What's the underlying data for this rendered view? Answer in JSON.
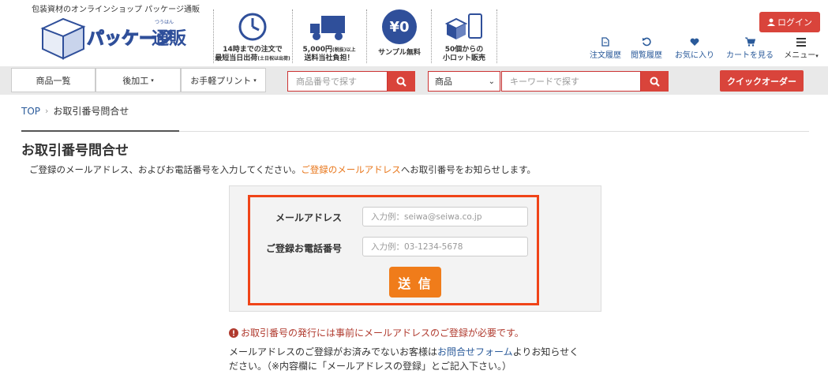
{
  "header": {
    "tagline": "包装資材のオンラインショップ パッケージ通販",
    "logo_text": "パッケージ通販",
    "logo_ruby": "つうはん",
    "features": [
      {
        "line1": "14時までの注文で",
        "line2": "最短当日出荷",
        "note": "(土日祝は出荷)",
        "icon": "clock-icon"
      },
      {
        "line1": "5,000円",
        "line1b": "(税抜)以上",
        "line2": "送料当社負担！",
        "icon": "truck-icon"
      },
      {
        "line1": "サンプル無料",
        "badge": "¥0",
        "icon": "yen-zero-icon"
      },
      {
        "line1": "50個からの",
        "line2": "小ロット販売",
        "icon": "boxes-icon"
      }
    ],
    "login_label": "ログイン",
    "nav": [
      {
        "label": "注文履歴",
        "icon": "document-icon"
      },
      {
        "label": "閲覧履歴",
        "icon": "history-icon"
      },
      {
        "label": "お気に入り",
        "icon": "heart-icon"
      },
      {
        "label": "カートを見る",
        "icon": "cart-icon"
      },
      {
        "label": "メニュー",
        "icon": "hamburger-icon"
      }
    ]
  },
  "toolbar": {
    "product_list": "商品一覧",
    "post_processing": "後加工",
    "easy_print": "お手軽プリント",
    "product_number_placeholder": "商品番号で探す",
    "category_selected": "商品",
    "keyword_placeholder": "キーワードで探す",
    "quick_order": "クイックオーダー"
  },
  "breadcrumb": {
    "home": "TOP",
    "current": "お取引番号問合せ"
  },
  "page": {
    "title": "お取引番号問合せ",
    "intro_before": "ご登録のメールアドレス、およびお電話番号を入力してください。",
    "intro_highlight": "ご登録のメールアドレス",
    "intro_after": "へお取引番号をお知らせします。"
  },
  "form": {
    "email_label": "メールアドレス",
    "email_placeholder": "入力例：seiwa@seiwa.co.jp",
    "phone_label": "ご登録お電話番号",
    "phone_placeholder": "入力例：03-1234-5678",
    "submit_label": "送 信"
  },
  "notes": {
    "warning": "お取引番号の発行には事前にメールアドレスのご登録が必要です。",
    "text_before": "メールアドレスのご登録がお済みでないお客様は",
    "link": "お問合せフォーム",
    "text_after": "よりお知らせく",
    "text_line2": "ださい。（※内容欄に「メールアドレスの登録」とご記入下さい。）"
  },
  "colors": {
    "brand_red": "#d9443b",
    "link_blue": "#2a5a9a",
    "orange": "#f07c1a",
    "highlight_border": "#f04418"
  }
}
